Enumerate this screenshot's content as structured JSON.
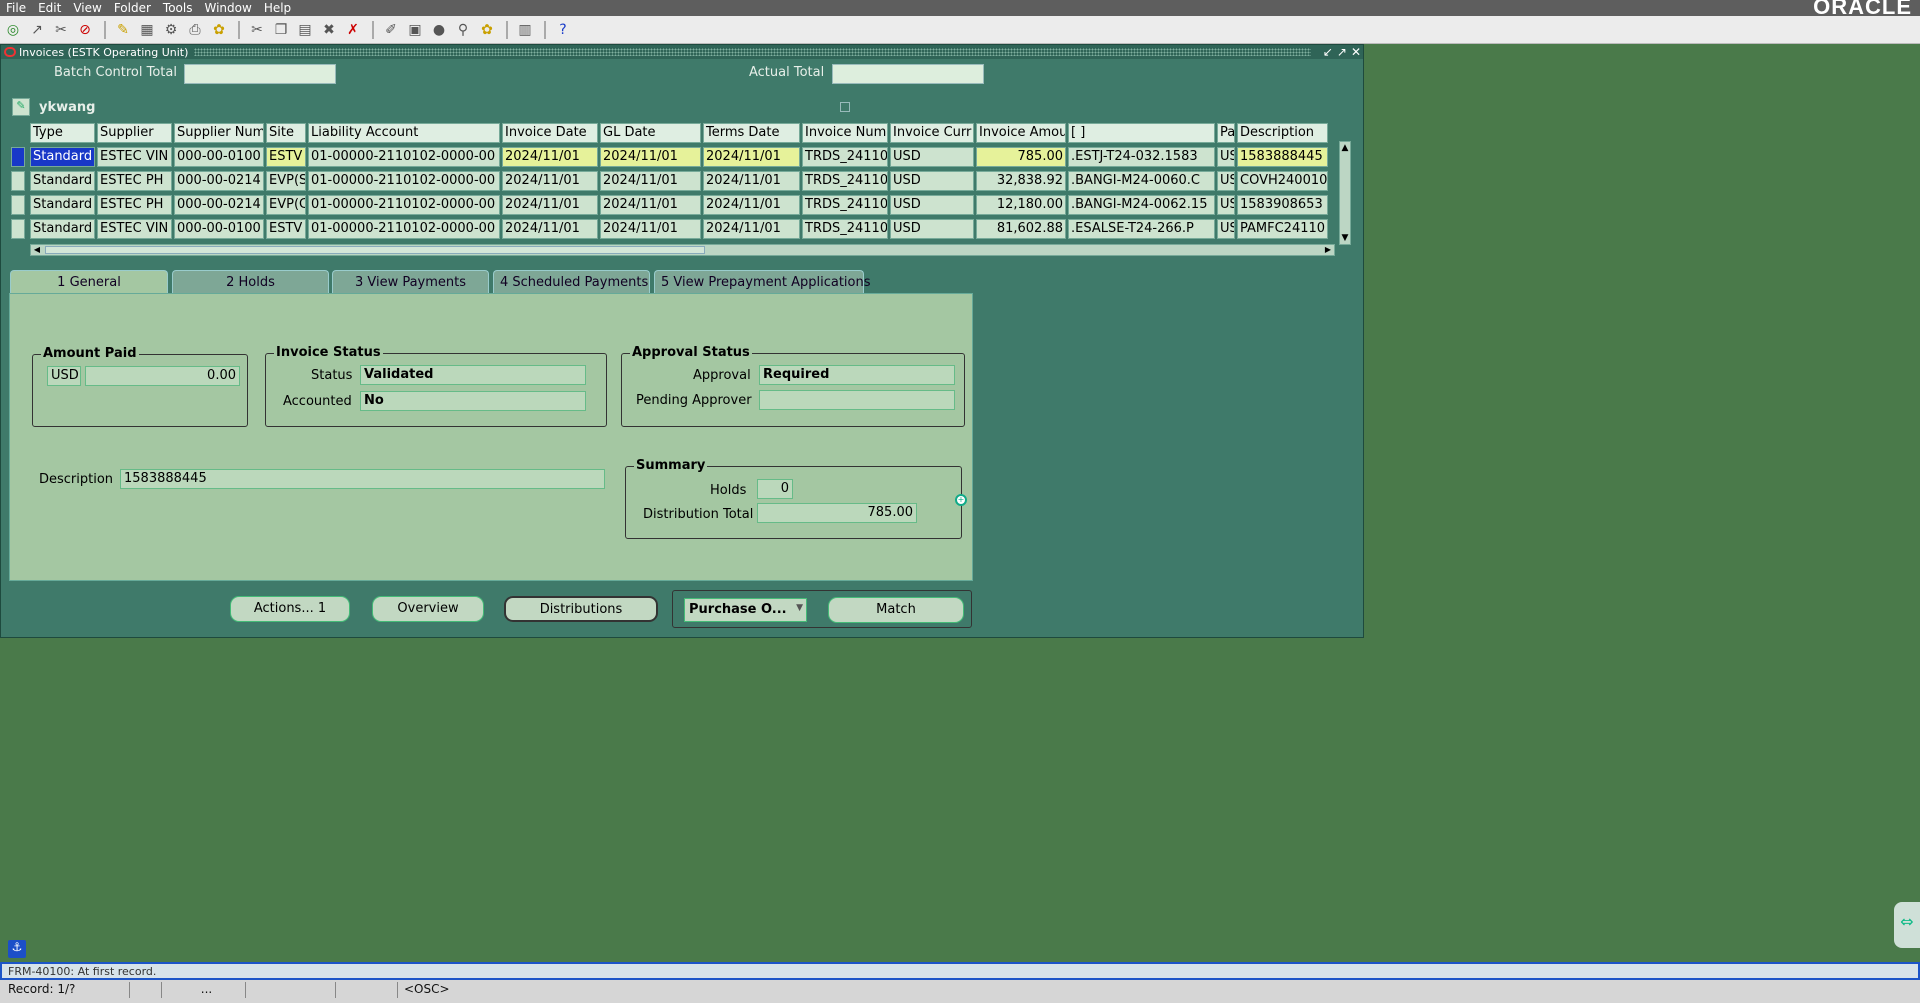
{
  "menu": [
    "File",
    "Edit",
    "View",
    "Folder",
    "Tools",
    "Window",
    "Help"
  ],
  "brand": "ORACLE",
  "window": {
    "title": "Invoices (ESTK Operating Unit)",
    "batch_label": "Batch Control Total",
    "actual_label": "Actual Total",
    "user": "ykwang"
  },
  "columns": [
    "Type",
    "Supplier",
    "Supplier Num",
    "Site",
    "Liability Account",
    "Invoice Date",
    "GL Date",
    "Terms Date",
    "Invoice Num",
    "Invoice Curr",
    "Invoice Amoui",
    "[ ]",
    "Pa",
    "Description"
  ],
  "rows": [
    [
      "Standard",
      "ESTEC VIN",
      "000-00-0100",
      "ESTV",
      "01-00000-2110102-0000-00",
      "2024/11/01",
      "2024/11/01",
      "2024/11/01",
      "TRDS_24110",
      "USD",
      "785.00",
      ".ESTJ-T24-032.1583",
      "US",
      "1583888445"
    ],
    [
      "Standard",
      "ESTEC PH",
      "000-00-0214",
      "EVP(S",
      "01-00000-2110102-0000-00",
      "2024/11/01",
      "2024/11/01",
      "2024/11/01",
      "TRDS_24110",
      "USD",
      "32,838.92",
      ".BANGI-M24-0060.C",
      "US",
      "COVH240010"
    ],
    [
      "Standard",
      "ESTEC PH",
      "000-00-0214",
      "EVP(C",
      "01-00000-2110102-0000-00",
      "2024/11/01",
      "2024/11/01",
      "2024/11/01",
      "TRDS_24110",
      "USD",
      "12,180.00",
      ".BANGI-M24-0062.15",
      "US",
      "1583908653"
    ],
    [
      "Standard",
      "ESTEC VIN",
      "000-00-0100",
      "ESTV",
      "01-00000-2110102-0000-00",
      "2024/11/01",
      "2024/11/01",
      "2024/11/01",
      "TRDS_24110",
      "USD",
      "81,602.88",
      ".ESALSE-T24-266.P",
      "US",
      "PAMFC24110"
    ]
  ],
  "tabs": [
    "1 General",
    "2 Holds",
    "3 View Payments",
    "4 Scheduled Payments",
    "5 View Prepayment Applications"
  ],
  "general": {
    "amount_paid_title": "Amount Paid",
    "currency": "USD",
    "amount_paid": "0.00",
    "invoice_status_title": "Invoice Status",
    "status_label": "Status",
    "status_value": "Validated",
    "accounted_label": "Accounted",
    "accounted_value": "No",
    "approval_status_title": "Approval Status",
    "approval_label": "Approval",
    "approval_value": "Required",
    "pending_label": "Pending Approver",
    "pending_value": "",
    "description_label": "Description",
    "description_value": "1583888445",
    "summary_title": "Summary",
    "holds_label": "Holds",
    "holds_value": "0",
    "dist_label": "Distribution Total",
    "dist_value": "785.00"
  },
  "buttons": {
    "actions": "Actions... 1",
    "overview": "Overview",
    "distributions": "Distributions",
    "purchase": "Purchase O...",
    "match": "Match"
  },
  "status": {
    "message": "FRM-40100: At first record.",
    "record": "Record: 1/?",
    "ellipsis": "...",
    "osc": "<OSC>"
  }
}
